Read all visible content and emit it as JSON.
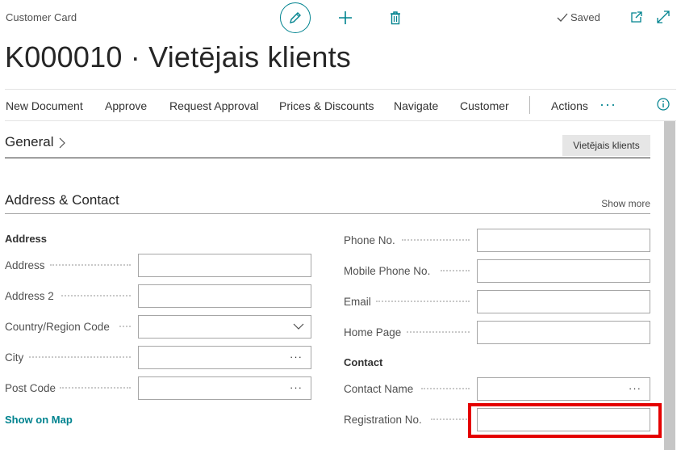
{
  "header": {
    "page_kind": "Customer Card",
    "saved_label": "Saved",
    "title": "K000010 · Vietējais klients"
  },
  "actions": {
    "items": [
      "New Document",
      "Approve",
      "Request Approval",
      "Prices & Discounts",
      "Navigate",
      "Customer",
      "Actions"
    ],
    "more": "···"
  },
  "general": {
    "title": "General",
    "summary": "Vietējais klients"
  },
  "address_contact": {
    "title": "Address & Contact",
    "show_more": "Show more",
    "address_caption": "Address",
    "address_label": "Address",
    "address_value": "",
    "address2_label": "Address 2",
    "address2_value": "",
    "country_label": "Country/Region Code",
    "country_value": "",
    "city_label": "City",
    "city_value": "",
    "postcode_label": "Post Code",
    "postcode_value": "",
    "show_on_map": "Show on Map",
    "phone_label": "Phone No.",
    "phone_value": "",
    "mobile_label": "Mobile Phone No.",
    "mobile_value": "",
    "email_label": "Email",
    "email_value": "",
    "homepage_label": "Home Page",
    "homepage_value": "",
    "contact_caption": "Contact",
    "contact_name_label": "Contact Name",
    "contact_name_value": "",
    "registration_label": "Registration No.",
    "registration_value": "",
    "lookup_glyph": "···"
  },
  "colors": {
    "accent": "#00838f",
    "highlight": "#e40000"
  }
}
